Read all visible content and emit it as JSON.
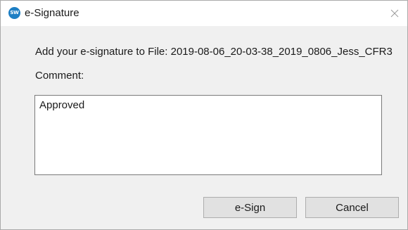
{
  "window": {
    "title": "e-Signature",
    "app_icon_text": "SW",
    "icon_names": {
      "app": "solidworks-logo-icon",
      "close": "close-icon"
    },
    "colors": {
      "app_icon": "#1e7fc4",
      "titlebar": "#ffffff",
      "body": "#f0f0f0",
      "button": "#e1e1e1"
    }
  },
  "dialog": {
    "prompt": "Add your e-signature to File: 2019-08-06_20-03-38_2019_0806_Jess_CFR3",
    "comment_label": "Comment:",
    "comment_value": "Approved"
  },
  "buttons": {
    "sign_label": "e-Sign",
    "cancel_label": "Cancel"
  }
}
